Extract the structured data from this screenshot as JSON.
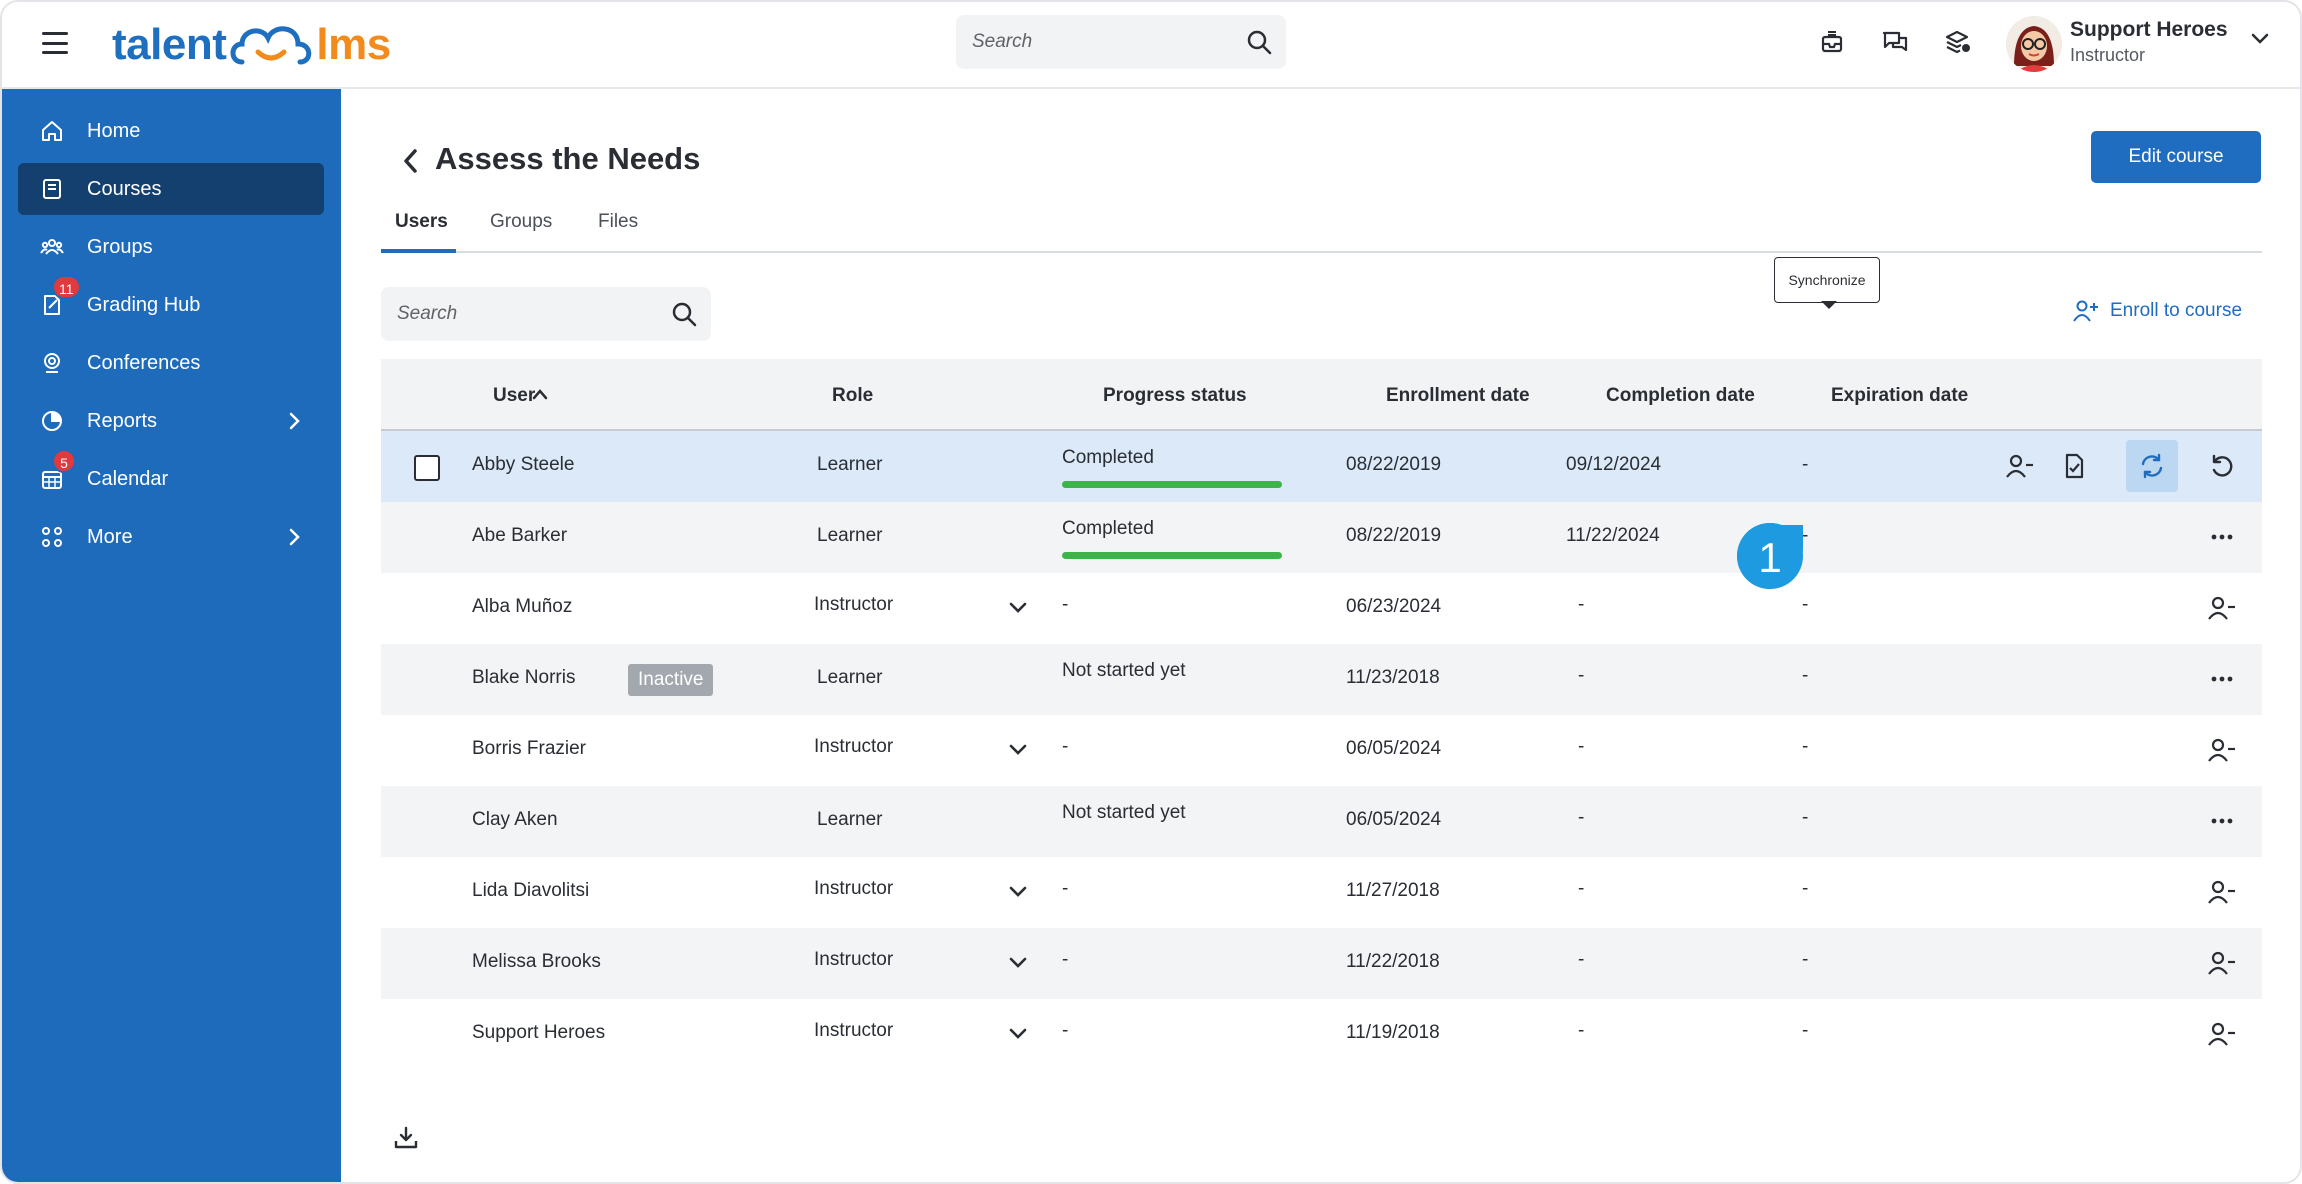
{
  "app": {
    "logo_left": "talent",
    "logo_right": "lms",
    "search_placeholder": "Search",
    "profile": {
      "name": "Support Heroes",
      "role": "Instructor"
    }
  },
  "sidebar": {
    "items": [
      {
        "label": "Home",
        "icon": "home-icon"
      },
      {
        "label": "Courses",
        "icon": "courses-icon",
        "active": true
      },
      {
        "label": "Groups",
        "icon": "groups-icon"
      },
      {
        "label": "Grading Hub",
        "icon": "grading-hub-icon",
        "badge": "11"
      },
      {
        "label": "Conferences",
        "icon": "conferences-icon"
      },
      {
        "label": "Reports",
        "icon": "reports-icon",
        "has_submenu": true
      },
      {
        "label": "Calendar",
        "icon": "calendar-icon",
        "badge": "5"
      },
      {
        "label": "More",
        "icon": "more-icon",
        "has_submenu": true
      }
    ]
  },
  "course": {
    "title": "Assess the Needs",
    "edit_label": "Edit course",
    "tabs": [
      "Users",
      "Groups",
      "Files"
    ],
    "search_placeholder": "Search",
    "enroll_label": "Enroll to course"
  },
  "table": {
    "headers": {
      "user": "User",
      "role": "Role",
      "progress": "Progress status",
      "enrollment": "Enrollment date",
      "completion": "Completion date",
      "expiration": "Expiration date"
    },
    "tooltip": "Synchronize",
    "step_marker": "1",
    "rows": [
      {
        "user": "Abby Steele",
        "role": "Learner",
        "progress": "Completed",
        "progress_value": 1.0,
        "enrollment": "08/22/2019",
        "completion": "09/12/2024",
        "expiration": "-"
      },
      {
        "user": "Abe Barker",
        "role": "Learner",
        "progress": "Completed",
        "progress_value": 1.0,
        "enrollment": "08/22/2019",
        "completion": "11/22/2024",
        "expiration": "-"
      },
      {
        "user": "Alba Muñoz",
        "role": "Instructor",
        "progress": "-",
        "enrollment": "06/23/2024",
        "completion": "-",
        "expiration": "-"
      },
      {
        "user": "Blake Norris",
        "tag": "Inactive",
        "role": "Learner",
        "progress": "Not started yet",
        "enrollment": "11/23/2018",
        "completion": "-",
        "expiration": "-"
      },
      {
        "user": "Borris Frazier",
        "role": "Instructor",
        "progress": "-",
        "enrollment": "06/05/2024",
        "completion": "-",
        "expiration": "-"
      },
      {
        "user": "Clay Aken",
        "role": "Learner",
        "progress": "Not started yet",
        "enrollment": "06/05/2024",
        "completion": "-",
        "expiration": "-"
      },
      {
        "user": "Lida Diavolitsi",
        "role": "Instructor",
        "progress": "-",
        "enrollment": "11/27/2018",
        "completion": "-",
        "expiration": "-"
      },
      {
        "user": "Melissa Brooks",
        "role": "Instructor",
        "progress": "-",
        "enrollment": "11/22/2018",
        "completion": "-",
        "expiration": "-"
      },
      {
        "user": "Support Heroes",
        "role": "Instructor",
        "progress": "-",
        "enrollment": "11/19/2018",
        "completion": "-",
        "expiration": "-"
      }
    ]
  },
  "colors": {
    "brand_blue": "#1e6abb",
    "active_nav": "#14406f",
    "progress_green": "#3cb44a",
    "badge_red": "#e03a3e",
    "selected_row": "#dbe9f8"
  }
}
